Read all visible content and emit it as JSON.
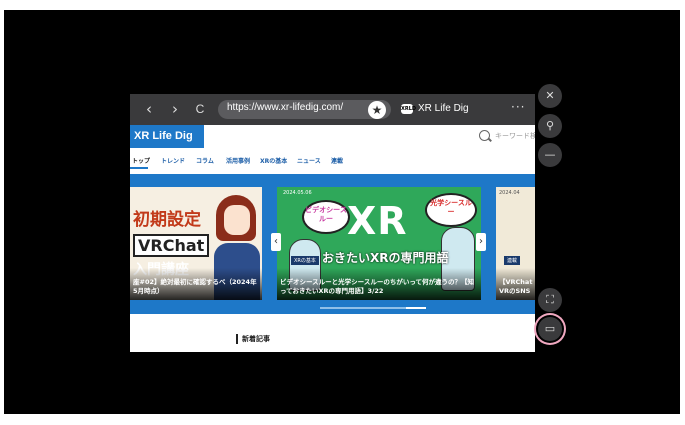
{
  "browser": {
    "back": "‹",
    "forward": "›",
    "reload": "C",
    "url": "https://www.xr-lifedig.com/",
    "favicon_text": "XRLD",
    "tab_title": "XR Life Dig",
    "more": "···"
  },
  "site": {
    "logo": "XR Life Dig",
    "search_placeholder": "キーワード検",
    "nav": [
      "トップ",
      "トレンド",
      "コラム",
      "活用事例",
      "XRの基本",
      "ニュース",
      "連載"
    ],
    "section_title": "新着記事"
  },
  "hero": {
    "card1": {
      "line1": "初期設定",
      "line2": "VRChat",
      "line3": "入門講座",
      "caption": "座#02】絶対最初に確認するべ（2024年5月時点）"
    },
    "card2": {
      "date": "2024.05.06",
      "bubble_left": "ビデオシースルー",
      "xr": "XR",
      "bubble_right": "光学シースルー",
      "tag": "XRの基本",
      "headline": "おきたいXRの専門用語",
      "caption": "ビデオシースルーと光学シースルーのちがいって何が違うの？【知っておきたいXRの専門用語】3/22"
    },
    "card3": {
      "date": "2024.04",
      "tag": "連載",
      "caption": "【VRChat VRのSNS"
    },
    "prev": "‹",
    "next": "›"
  },
  "side_panel": {
    "close": "✕",
    "pin": "⚲",
    "minimize": "—",
    "fullscreen": "⛶",
    "pip": "▭"
  }
}
